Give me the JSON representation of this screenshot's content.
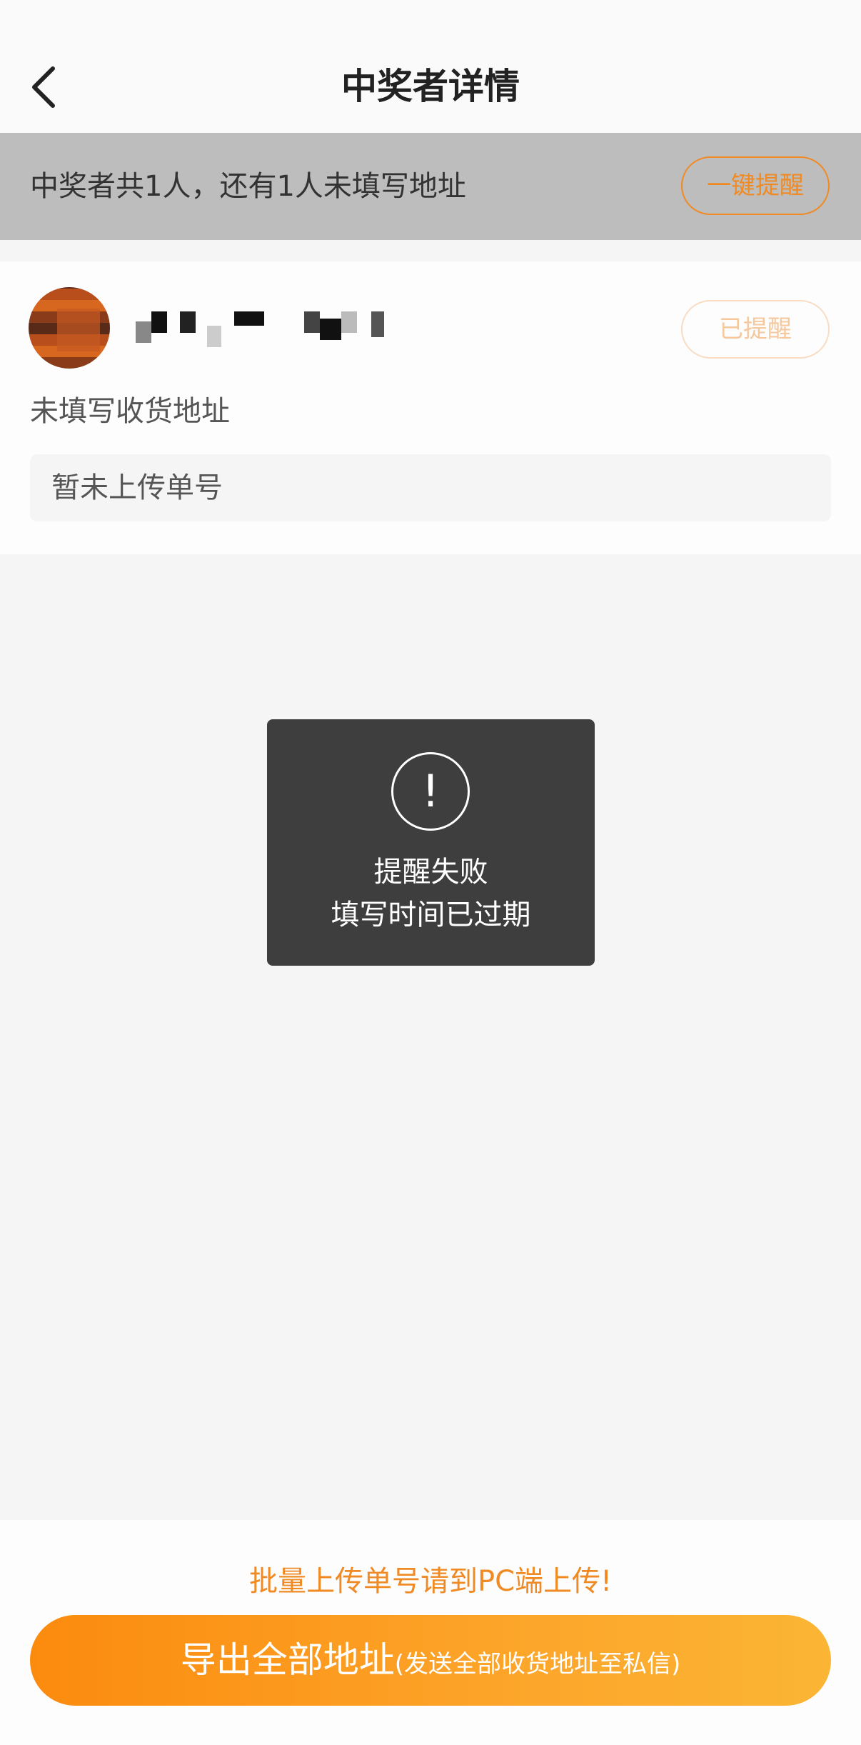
{
  "header": {
    "title": "中奖者详情"
  },
  "banner": {
    "summary": "中奖者共1人，还有1人未填写地址",
    "remind_all_label": "一键提醒"
  },
  "winner": {
    "reminded_label": "已提醒",
    "address_status": "未填写收货地址",
    "tracking_placeholder": "暂未上传单号"
  },
  "toast": {
    "icon": "alert-circle-icon",
    "glyph": "!",
    "line1": "提醒失败",
    "line2": "填写时间已过期"
  },
  "footer": {
    "pc_note": "批量上传单号请到PC端上传!",
    "export_label": "导出全部地址",
    "export_sub": "(发送全部收货地址至私信)"
  },
  "colors": {
    "accent": "#f08a24",
    "banner_bg": "#bdbdbd",
    "toast_bg": "#3e3e3e"
  }
}
